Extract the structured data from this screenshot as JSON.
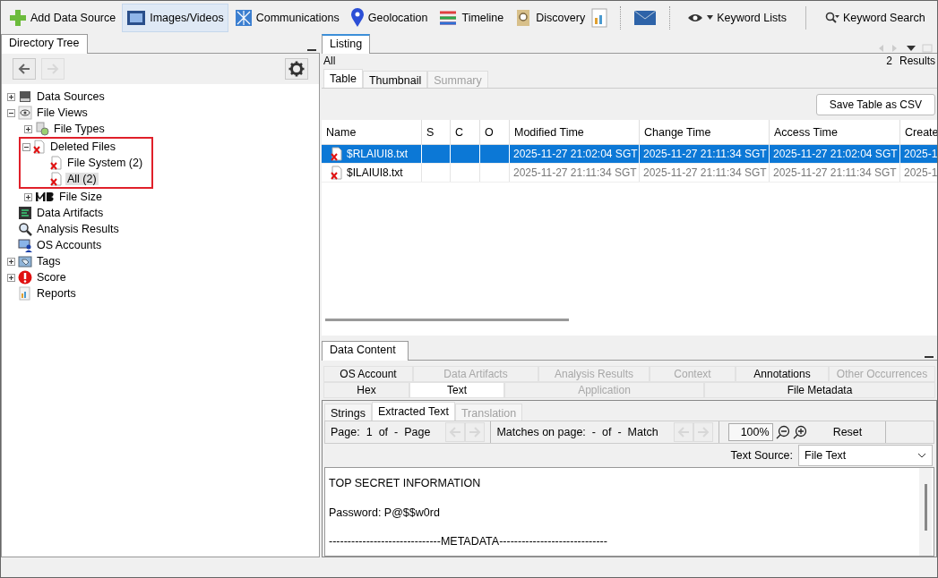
{
  "toolbar": {
    "items": [
      {
        "label": "Add Data Source",
        "selected": false
      },
      {
        "label": "Images/Videos",
        "selected": true
      },
      {
        "label": "Communications",
        "selected": false
      },
      {
        "label": "Geolocation",
        "selected": false
      },
      {
        "label": "Timeline",
        "selected": false
      },
      {
        "label": "Discovery",
        "selected": false
      }
    ],
    "keyword_lists": "Keyword Lists",
    "keyword_search": "Keyword Search"
  },
  "directory_tree": {
    "title": "Directory Tree",
    "items": [
      {
        "label": "Data Sources",
        "expanded": false,
        "selected": false
      },
      {
        "label": "File Views",
        "expanded": true,
        "selected": false,
        "children": [
          {
            "label": "File Types",
            "expanded": false,
            "selected": false
          },
          {
            "label": "Deleted Files",
            "expanded": true,
            "selected": false,
            "outlined": true,
            "children": [
              {
                "label": "File System (2)",
                "selected": false
              },
              {
                "label": "All (2)",
                "selected": true
              }
            ]
          },
          {
            "label": "File Size",
            "expanded": false,
            "selected": false
          }
        ]
      },
      {
        "label": "Data Artifacts",
        "selected": false
      },
      {
        "label": "Analysis Results",
        "selected": false
      },
      {
        "label": "OS Accounts",
        "selected": false
      },
      {
        "label": "Tags",
        "expanded": false,
        "selected": false
      },
      {
        "label": "Score",
        "expanded": false,
        "selected": false
      },
      {
        "label": "Reports",
        "selected": false
      }
    ]
  },
  "listing": {
    "tab": "Listing",
    "path": "All",
    "count": "2",
    "count_label": "Results",
    "tabs": [
      {
        "label": "Table",
        "selected": true,
        "disabled": false
      },
      {
        "label": "Thumbnail",
        "selected": false,
        "disabled": false
      },
      {
        "label": "Summary",
        "selected": false,
        "disabled": true
      }
    ],
    "save_button": "Save Table as CSV",
    "table": {
      "columns": [
        "Name",
        "S",
        "C",
        "O",
        "Modified Time",
        "Change Time",
        "Access Time",
        "Create"
      ],
      "rows": [
        {
          "selected": true,
          "cells": [
            "$RLAIUI8.txt",
            "",
            "",
            "",
            "2025-11-27 21:02:04 SGT",
            "2025-11-27 21:11:34 SGT",
            "2025-11-27 21:02:04 SGT",
            "2025-1"
          ]
        },
        {
          "selected": false,
          "cells": [
            "$ILAIUI8.txt",
            "",
            "",
            "",
            "2025-11-27 21:11:34 SGT",
            "2025-11-27 21:11:34 SGT",
            "2025-11-27 21:11:34 SGT",
            "2025-1"
          ]
        }
      ]
    }
  },
  "data_content": {
    "tab": "Data Content",
    "tabs_row_1": [
      {
        "label": "OS Account",
        "disabled": false,
        "selected": false
      },
      {
        "label": "Data Artifacts",
        "disabled": true,
        "selected": false
      },
      {
        "label": "Analysis Results",
        "disabled": true,
        "selected": false
      },
      {
        "label": "Context",
        "disabled": true,
        "selected": false
      },
      {
        "label": "Annotations",
        "disabled": false,
        "selected": false
      },
      {
        "label": "Other Occurrences",
        "disabled": true,
        "selected": false
      }
    ],
    "tabs_row_2": [
      {
        "label": "Hex",
        "disabled": false,
        "selected": false
      },
      {
        "label": "Text",
        "disabled": false,
        "selected": true
      },
      {
        "label": "Application",
        "disabled": true,
        "selected": false
      },
      {
        "label": "File Metadata",
        "disabled": false,
        "selected": false
      }
    ],
    "sub_tabs": [
      {
        "label": "Strings",
        "selected": false,
        "disabled": false
      },
      {
        "label": "Extracted Text",
        "selected": true,
        "disabled": false
      },
      {
        "label": "Translation",
        "selected": false,
        "disabled": true
      }
    ],
    "page": {
      "label": "Page:",
      "current": "1",
      "of": "of",
      "total": "-",
      "unit": "Page"
    },
    "matches": {
      "label": "Matches on page:",
      "current": "-",
      "of": "of",
      "total": "-",
      "unit": "Match"
    },
    "zoom": "100%",
    "reset": "Reset",
    "text_source": {
      "label": "Text Source:",
      "value": "File Text"
    },
    "lines": [
      "TOP SECRET INFORMATION",
      "Password: P@$$w0rd",
      "------------------------------METADATA-----------------------------"
    ]
  }
}
